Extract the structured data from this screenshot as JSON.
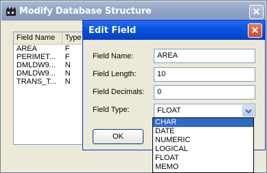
{
  "outer_window": {
    "title": "Modify Database Structure",
    "close_label": "✕"
  },
  "field_list": {
    "columns": [
      "Field Name",
      "Type"
    ],
    "rows": [
      {
        "name": "AREA",
        "type": "F"
      },
      {
        "name": "PERIMET...",
        "type": "F"
      },
      {
        "name": "DMLDW9...",
        "type": "N"
      },
      {
        "name": "DMLDW9...",
        "type": "N"
      },
      {
        "name": "TRANS_T...",
        "type": "N"
      }
    ]
  },
  "dialog": {
    "title": "Edit Field",
    "close_label": "✕",
    "labels": {
      "name": "Field Name:",
      "length": "Field Length:",
      "decimals": "Field Decimals:",
      "type": "Field Type:"
    },
    "values": {
      "name": "AREA",
      "length": "10",
      "decimals": "0",
      "type": "FLOAT"
    },
    "ok_label": "OK"
  },
  "dropdown": {
    "options": [
      "CHAR",
      "DATE",
      "NUMERIC",
      "LOGICAL",
      "FLOAT",
      "MEMO"
    ],
    "highlighted": "CHAR"
  },
  "colors": {
    "dialog_title": "#0a55e0",
    "outer_title_inactive": "#8fa2c4",
    "selection": "#316ac5"
  }
}
